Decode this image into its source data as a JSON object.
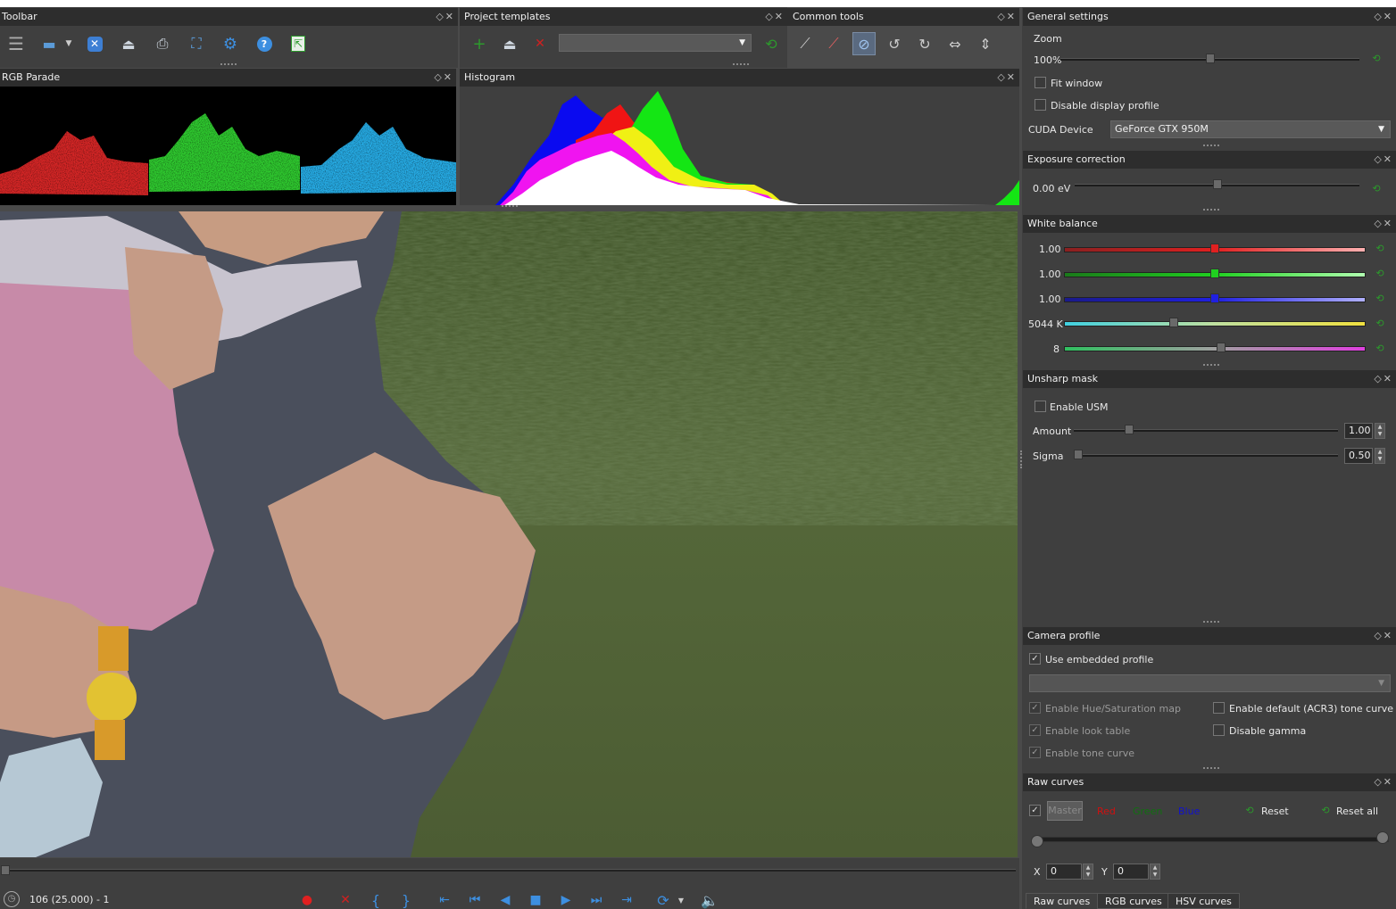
{
  "toolbar": {
    "title": "Toolbar"
  },
  "project_templates": {
    "title": "Project templates",
    "combo_value": ""
  },
  "common_tools": {
    "title": "Common tools"
  },
  "rgb_parade": {
    "title": "RGB Parade"
  },
  "histogram": {
    "title": "Histogram"
  },
  "general_settings": {
    "title": "General settings",
    "zoom_label": "Zoom",
    "zoom_value": "100%",
    "zoom_level": 0.5,
    "fit_window": "Fit window",
    "disable_display_profile": "Disable display profile",
    "cuda_label": "CUDA Device",
    "cuda_value": "GeForce GTX 950M"
  },
  "exposure": {
    "title": "Exposure correction",
    "value": "0.00 eV",
    "level": 0.5
  },
  "white_balance": {
    "title": "White balance",
    "rows": [
      {
        "value": "1.00",
        "level": 0.5
      },
      {
        "value": "1.00",
        "level": 0.5
      },
      {
        "value": "1.00",
        "level": 0.5
      },
      {
        "value": "5044 K",
        "level": 0.36
      },
      {
        "value": "8",
        "level": 0.52
      }
    ]
  },
  "unsharp": {
    "title": "Unsharp mask",
    "enable": "Enable USM",
    "amount_label": "Amount",
    "amount_value": "1.00",
    "amount_level": 0.2,
    "sigma_label": "Sigma",
    "sigma_value": "0.50",
    "sigma_level": 0.0
  },
  "camera_profile": {
    "title": "Camera profile",
    "use_embedded": "Use embedded profile",
    "enable_hue_sat": "Enable Hue/Saturation map",
    "enable_look": "Enable look table",
    "enable_tone": "Enable tone curve",
    "enable_default_tone": "Enable default (ACR3) tone curve",
    "disable_gamma": "Disable gamma"
  },
  "raw_curves": {
    "title": "Raw curves",
    "master": "Master",
    "red": "Red",
    "green": "Green",
    "blue": "Blue",
    "reset": "Reset",
    "reset_all": "Reset all",
    "x_label": "X",
    "x_value": "0",
    "y_label": "Y",
    "y_value": "0"
  },
  "bottom_tabs": [
    "Raw curves",
    "RGB curves",
    "HSV curves"
  ],
  "playback": {
    "frame_info": "106 (25.000) - 1"
  },
  "colors": {
    "accent_blue": "#2a7fd4",
    "reset_green": "#2c9a2c",
    "record_red": "#e02020"
  }
}
